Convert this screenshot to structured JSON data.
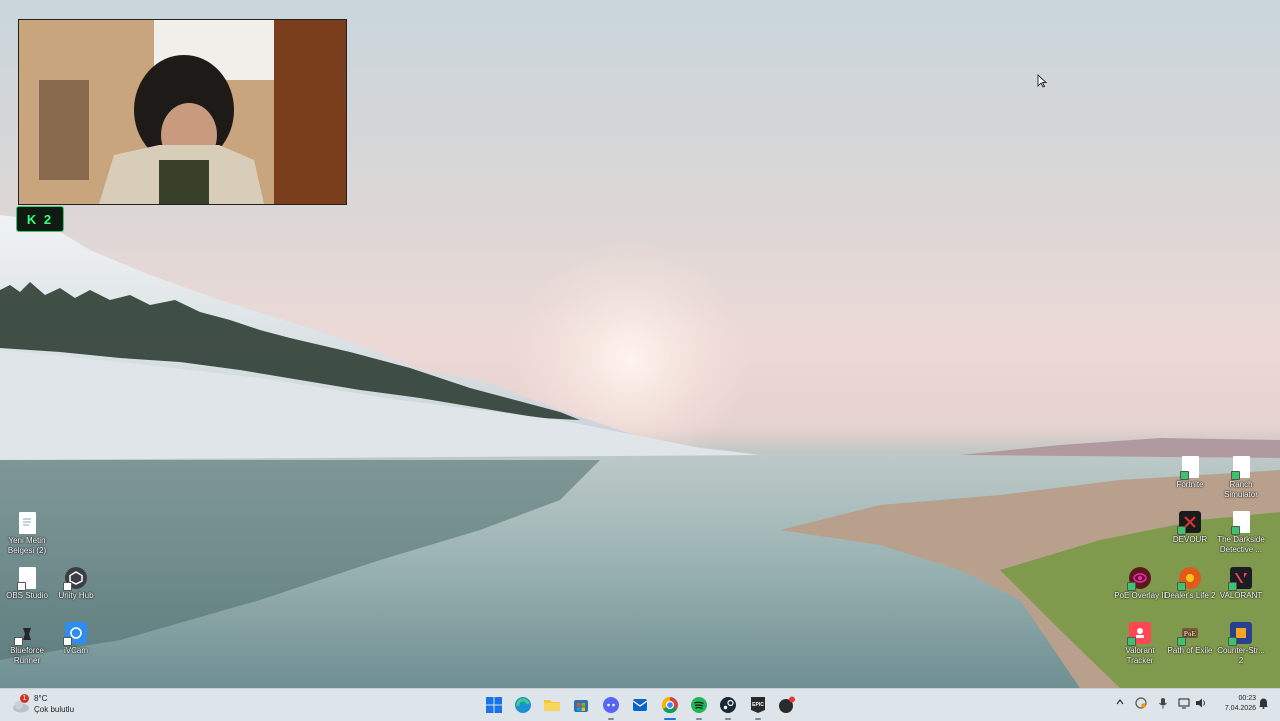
{
  "desktop": {
    "icons_left": [
      {
        "label": "Yeni Metin Belgesi (2)",
        "icon": "text-document-icon"
      },
      {
        "label": "OBS Studio",
        "icon": "document-icon"
      },
      {
        "label": "Unity Hub",
        "icon": "unity-hub-icon"
      },
      {
        "label": "Blueforce Runner",
        "icon": "blueforce-runner-icon"
      },
      {
        "label": "iVCam",
        "icon": "ivcam-icon"
      }
    ],
    "icons_right": [
      {
        "label": "Fortnite",
        "icon": "document-icon"
      },
      {
        "label": "Ranch Simulator",
        "icon": "document-icon"
      },
      {
        "label": "DEVOUR",
        "icon": "devour-icon"
      },
      {
        "label": "The Darkside Detective ...",
        "icon": "document-icon"
      },
      {
        "label": "PoE Overlay II",
        "icon": "poe-overlay-icon"
      },
      {
        "label": "Dealer's Life 2",
        "icon": "dealers-life-icon"
      },
      {
        "label": "VALORANT",
        "icon": "valorant-icon"
      },
      {
        "label": "Valorant Tracker",
        "icon": "valorant-tracker-icon"
      },
      {
        "label": "Path of Exile",
        "icon": "path-of-exile-icon"
      },
      {
        "label": "Counter-Str... 2",
        "icon": "counter-strike-icon"
      }
    ],
    "overlay_badge": "K 2"
  },
  "taskbar": {
    "weather": {
      "temp": "8°C",
      "condition": "Çok bulutlu",
      "badge": "1"
    },
    "apps": [
      {
        "name": "start-button",
        "icon": "windows-start-icon"
      },
      {
        "name": "edge",
        "icon": "edge-icon"
      },
      {
        "name": "file-explorer",
        "icon": "folder-icon"
      },
      {
        "name": "store",
        "icon": "store-icon"
      },
      {
        "name": "discord",
        "icon": "discord-icon"
      },
      {
        "name": "outlook",
        "icon": "mail-icon"
      },
      {
        "name": "chrome",
        "icon": "chrome-icon"
      },
      {
        "name": "spotify",
        "icon": "spotify-icon"
      },
      {
        "name": "steam",
        "icon": "steam-icon"
      },
      {
        "name": "epic-games",
        "icon": "epic-games-icon"
      },
      {
        "name": "recorder",
        "icon": "record-icon"
      }
    ],
    "clock": {
      "time": "00:23",
      "date": "7.04.2026"
    }
  },
  "colors": {
    "taskbar_bg": "#dde5ea",
    "badge_green": "#35ff7a"
  }
}
